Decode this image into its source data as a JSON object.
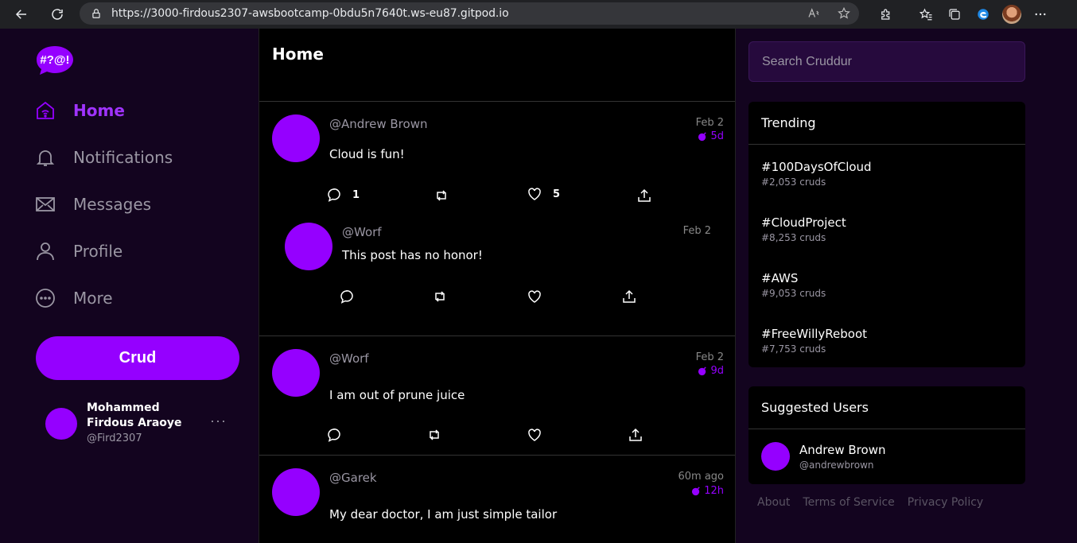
{
  "browser": {
    "url": "https://3000-firdous2307-awsbootcamp-0bdu5n7640t.ws-eu87.gitpod.io"
  },
  "sidebar": {
    "logo_text": "#?@!",
    "nav": [
      {
        "label": "Home",
        "icon": "home-icon",
        "active": true
      },
      {
        "label": "Notifications",
        "icon": "bell-icon",
        "active": false
      },
      {
        "label": "Messages",
        "icon": "mail-icon",
        "active": false
      },
      {
        "label": "Profile",
        "icon": "user-icon",
        "active": false
      },
      {
        "label": "More",
        "icon": "more-icon",
        "active": false
      }
    ],
    "crud_button": "Crud",
    "profile": {
      "name": "Mohammed Firdous Araoye",
      "handle": "@Fird2307",
      "menu": "···"
    }
  },
  "feed": {
    "title": "Home",
    "posts": [
      {
        "handle": "@Andrew Brown",
        "message": "Cloud is fun!",
        "date": "Feb 2",
        "expires": "5d",
        "replies": "1",
        "likes": "5"
      },
      {
        "handle": "@Worf",
        "message": "This post has no honor!",
        "date": "Feb 2",
        "reply": true
      },
      {
        "handle": "@Worf",
        "message": "I am out of prune juice",
        "date": "Feb 2",
        "expires": "9d"
      },
      {
        "handle": "@Garek",
        "message": "My dear doctor, I am just simple tailor",
        "date": "60m ago",
        "expires": "12h"
      }
    ]
  },
  "right": {
    "search_placeholder": "Search Cruddur",
    "trending_title": "Trending",
    "trending": [
      {
        "tag": "#100DaysOfCloud",
        "count": "#2,053 cruds"
      },
      {
        "tag": "#CloudProject",
        "count": "#8,253 cruds"
      },
      {
        "tag": "#AWS",
        "count": "#9,053 cruds"
      },
      {
        "tag": "#FreeWillyReboot",
        "count": "#7,753 cruds"
      }
    ],
    "suggested_title": "Suggested Users",
    "suggested": [
      {
        "name": "Andrew Brown",
        "handle": "@andrewbrown"
      }
    ],
    "footer": [
      "About",
      "Terms of Service",
      "Privacy Policy"
    ]
  },
  "colors": {
    "accent": "#9500ff",
    "sidebar_bg": "#13041f",
    "feed_bg": "#000000"
  }
}
